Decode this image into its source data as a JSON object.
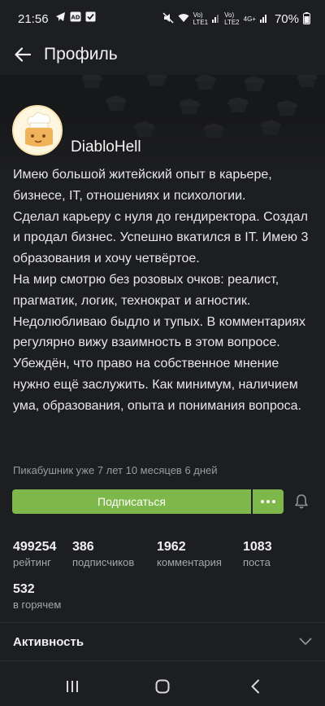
{
  "status_bar": {
    "time": "21:56",
    "battery_percent": "70%",
    "net1_line1": "Vo)",
    "net1_line2": "LTE1",
    "net2_line1": "Vo)",
    "net2_line2": "LTE2",
    "net2_type": "4G+",
    "left_icons": [
      "telegram-icon",
      "ad-icon",
      "checklist-icon"
    ],
    "right_icons": [
      "mute-icon",
      "wifi-icon",
      "signal-icon",
      "battery-icon"
    ]
  },
  "header": {
    "title": "Профиль"
  },
  "profile": {
    "username": "DiabloHell",
    "bio": "Имею большой житейский опыт в карьере, бизнесе, IT, отношениях и психологии.\nСделал карьеру с нуля до гендиректора. Создал и продал бизнес. Успешно вкатился в IT. Имею 3 образования и хочу четвёртое.\nНа мир смотрю без розовых очков: реалист, прагматик, логик, технократ и агностик. Недолюбливаю быдло и тупых. В комментариях регулярно вижу взаимность в этом вопросе.\nУбеждён, что право на собственное мнение нужно ещё заслужить. Как минимум, наличием ума, образования, опыта и понимания вопроса.",
    "since": "Пикабушник уже 7 лет 10 месяцев 6 дней"
  },
  "actions": {
    "subscribe_label": "Подписаться",
    "colors": {
      "button": "#7eb84a"
    }
  },
  "stats": [
    {
      "value": "499254",
      "label": "рейтинг"
    },
    {
      "value": "386",
      "label": "подписчиков"
    },
    {
      "value": "1962",
      "label": "комментария"
    },
    {
      "value": "1083",
      "label": "поста"
    },
    {
      "value": "532",
      "label": "в горячем"
    }
  ],
  "activity": {
    "label": "Активность"
  }
}
